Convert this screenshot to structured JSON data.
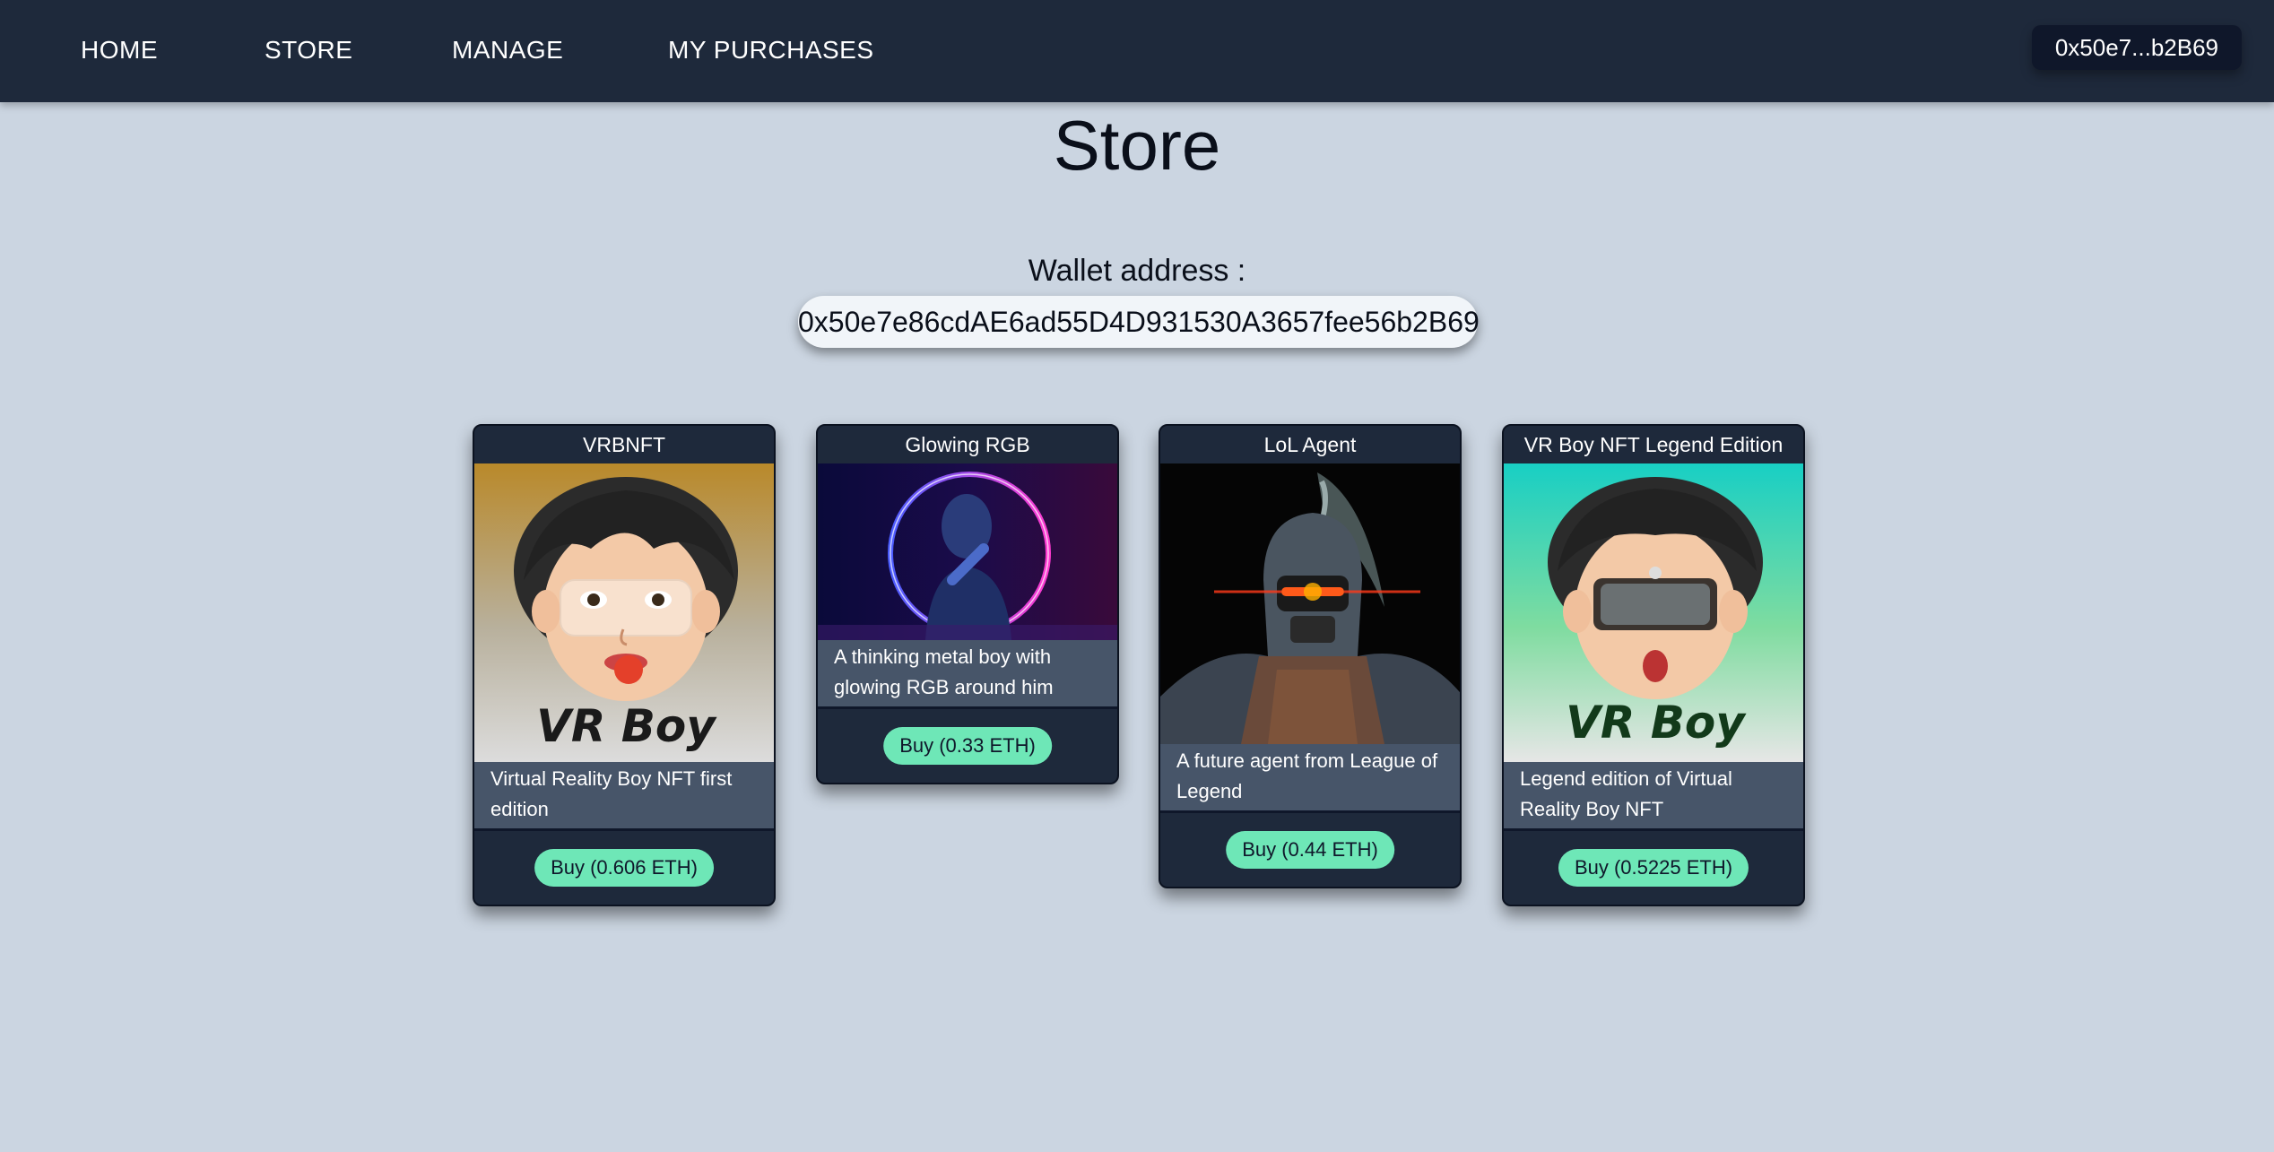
{
  "nav": {
    "home": "HOME",
    "store": "STORE",
    "manage": "MANAGE",
    "purchases": "MY PURCHASES",
    "wallet_short": "0x50e7...b2B69"
  },
  "page": {
    "title": "Store",
    "wallet_label": "Wallet address :",
    "wallet_address": "0x50e7e86cdAE6ad55D4D931530A3657fee56b2B69"
  },
  "cards": [
    {
      "title": "VRBNFT",
      "image_text": "VR Boy",
      "description": "Virtual Reality Boy NFT first edition",
      "buy_label": "Buy (0.606 ETH)"
    },
    {
      "title": "Glowing RGB",
      "description": "A thinking metal boy with glowing RGB around him",
      "buy_label": "Buy (0.33 ETH)"
    },
    {
      "title": "LoL Agent",
      "description": "A future agent from League of Legend",
      "buy_label": "Buy (0.44 ETH)"
    },
    {
      "title": "VR Boy NFT Legend Edition",
      "image_text": "VR Boy",
      "description": "Legend edition of Virtual Reality Boy NFT",
      "buy_label": "Buy (0.5225 ETH)"
    }
  ],
  "colors": {
    "page_bg": "#cbd5e1",
    "nav_bg": "#1e293b",
    "card_bg": "#1e293b",
    "desc_bg": "#475569",
    "buy_button": "#6ee7b7"
  }
}
